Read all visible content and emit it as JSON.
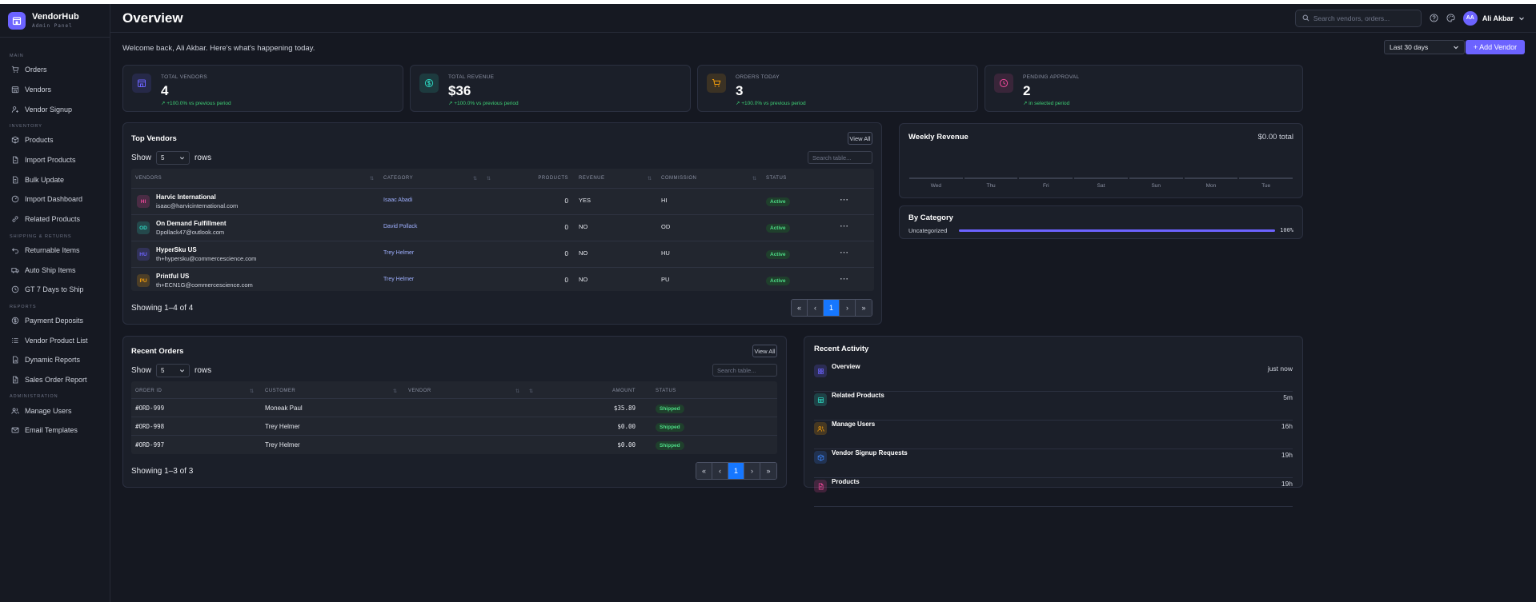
{
  "brand": {
    "name": "VendorHub",
    "subtitle": "Admin Panel",
    "accent": "#6c63ff"
  },
  "sidebar": {
    "sections": [
      {
        "title": "MAIN",
        "items": [
          {
            "label": "Orders",
            "icon": "cart-icon"
          },
          {
            "label": "Vendors",
            "icon": "store-icon"
          },
          {
            "label": "Vendor Signup",
            "icon": "user-plus-icon"
          }
        ]
      },
      {
        "title": "INVENTORY",
        "items": [
          {
            "label": "Products",
            "icon": "box-icon"
          },
          {
            "label": "Import Products",
            "icon": "file-import-icon"
          },
          {
            "label": "Bulk Update",
            "icon": "file-edit-icon"
          },
          {
            "label": "Import Dashboard",
            "icon": "dashboard-icon"
          },
          {
            "label": "Related Products",
            "icon": "link-icon"
          }
        ]
      },
      {
        "title": "SHIPPING & RETURNS",
        "items": [
          {
            "label": "Returnable Items",
            "icon": "return-icon"
          },
          {
            "label": "Auto Ship Items",
            "icon": "truck-icon"
          },
          {
            "label": "GT 7 Days to Ship",
            "icon": "clock-icon"
          }
        ]
      },
      {
        "title": "REPORTS",
        "items": [
          {
            "label": "Payment Deposits",
            "icon": "dollar-icon"
          },
          {
            "label": "Vendor Product List",
            "icon": "list-icon"
          },
          {
            "label": "Dynamic Reports",
            "icon": "report-icon"
          },
          {
            "label": "Sales Order Report",
            "icon": "document-icon"
          }
        ]
      },
      {
        "title": "ADMINISTRATION",
        "items": [
          {
            "label": "Manage Users",
            "icon": "users-icon"
          },
          {
            "label": "Email Templates",
            "icon": "mail-icon"
          }
        ]
      }
    ]
  },
  "header": {
    "title": "Overview",
    "search_placeholder": "Search vendors, orders...",
    "user": {
      "initials": "AA",
      "name": "Ali Akbar"
    }
  },
  "welcome": "Welcome back, Ali Akbar. Here's what's happening today.",
  "period": "Last 30 days",
  "add_vendor": "+ Add Vendor",
  "stats": [
    {
      "label": "TOTAL VENDORS",
      "value": "4",
      "change": "+100.0% vs previous period",
      "color": "#6c63ff",
      "icon": "store-icon"
    },
    {
      "label": "TOTAL REVENUE",
      "value": "$36",
      "change": "+100.0% vs previous period",
      "color": "#2dd4bf",
      "icon": "dollar-icon"
    },
    {
      "label": "ORDERS TODAY",
      "value": "3",
      "change": "+100.0% vs previous period",
      "color": "#f59e0b",
      "icon": "cart-icon"
    },
    {
      "label": "PENDING APPROVAL",
      "value": "2",
      "change": "in selected period",
      "color": "#ec4899",
      "icon": "clock-icon"
    }
  ],
  "top_vendors": {
    "title": "Top Vendors",
    "view_all": "View All",
    "show": "Show",
    "rows": "rows",
    "page_size": "5",
    "search_placeholder": "Search table...",
    "columns": [
      "VENDORS",
      "CATEGORY",
      "PRODUCTS",
      "REVENUE",
      "COMMISSION",
      "STATUS"
    ],
    "items": [
      {
        "initials": "HI",
        "name": "Harvic International",
        "email": "isaac@harvicinternational.com",
        "category": "Isaac Abadi",
        "products": "0",
        "revenue": "YES",
        "commission": "HI",
        "status": "Active",
        "color": "#ec4899"
      },
      {
        "initials": "OD",
        "name": "On Demand Fulfillment",
        "email": "Dpollack47@outlook.com",
        "category": "David Pollack",
        "products": "0",
        "revenue": "NO",
        "commission": "OD",
        "status": "Active",
        "color": "#2dd4bf"
      },
      {
        "initials": "HU",
        "name": "HyperSku US",
        "email": "th+hypersku@commercescience.com",
        "category": "Trey Helmer",
        "products": "0",
        "revenue": "NO",
        "commission": "HU",
        "status": "Active",
        "color": "#6c63ff"
      },
      {
        "initials": "PU",
        "name": "Printful US",
        "email": "th+ECN1G@commercescience.com",
        "category": "Trey Helmer",
        "products": "0",
        "revenue": "NO",
        "commission": "PU",
        "status": "Active",
        "color": "#f59e0b"
      }
    ],
    "showing": "Showing 1–4 of 4",
    "page": "1"
  },
  "weekly_revenue": {
    "title": "Weekly Revenue",
    "total": "$0.00 total",
    "days": [
      "Wed",
      "Thu",
      "Fri",
      "Sat",
      "Sun",
      "Mon",
      "Tue"
    ]
  },
  "by_category": {
    "title": "By Category",
    "items": [
      {
        "label": "Uncategorized",
        "percent": "100%",
        "value": 100
      }
    ]
  },
  "recent_orders": {
    "title": "Recent Orders",
    "view_all": "View All",
    "show": "Show",
    "rows": "rows",
    "page_size": "5",
    "search_placeholder": "Search table...",
    "columns": [
      "ORDER ID",
      "CUSTOMER",
      "VENDOR",
      "AMOUNT",
      "STATUS"
    ],
    "items": [
      {
        "id": "#ORD-999",
        "customer": "Moneak Paul",
        "vendor": "",
        "amount": "$35.89",
        "status": "Shipped"
      },
      {
        "id": "#ORD-998",
        "customer": "Trey Helmer",
        "vendor": "",
        "amount": "$0.00",
        "status": "Shipped"
      },
      {
        "id": "#ORD-997",
        "customer": "Trey Helmer",
        "vendor": "",
        "amount": "$0.00",
        "status": "Shipped"
      }
    ],
    "showing": "Showing 1–3 of 3",
    "page": "1"
  },
  "recent_activity": {
    "title": "Recent Activity",
    "items": [
      {
        "name": "Overview",
        "time": "just now",
        "color": "#6c63ff",
        "icon": "grid-icon"
      },
      {
        "name": "Related Products",
        "time": "5m",
        "color": "#2dd4bf",
        "icon": "table-icon"
      },
      {
        "name": "Manage Users",
        "time": "16h",
        "color": "#f59e0b",
        "icon": "users-icon"
      },
      {
        "name": "Vendor Signup Requests",
        "time": "19h",
        "color": "#3b82f6",
        "icon": "box-icon"
      },
      {
        "name": "Products",
        "time": "19h",
        "color": "#ec4899",
        "icon": "document-icon"
      }
    ]
  }
}
